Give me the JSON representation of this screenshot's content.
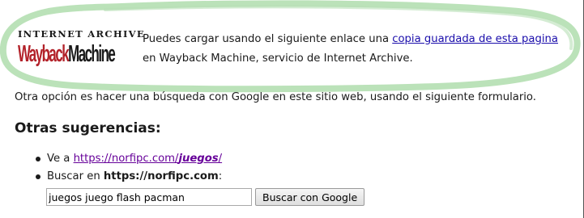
{
  "logo": {
    "top_text": "INTERNET ARCHIVE",
    "wordmark_part1": "Wayback",
    "wordmark_part2": "Machine",
    "brand_color": "#b3222a"
  },
  "intro": {
    "text_before": "Puedes cargar usando el siguiente enlace una ",
    "link_text": "copia guardada de esta pagina",
    "text_after": " en Wayback Machine, servicio de Internet Archive."
  },
  "alt_text": "Otra opción es hacer una búsqueda con Google en este sitio web, usando el siguiente formulario.",
  "suggestions": {
    "heading": "Otras sugerencias:",
    "item1_prefix": "Ve a ",
    "item1_link_base": "https://norfipc.com/",
    "item1_link_em": "juegos",
    "item1_link_tail": "/",
    "item2_prefix": "Buscar en ",
    "item2_bold": "https://norfipc.com",
    "item2_suffix": ":"
  },
  "search": {
    "value": "juegos juego flash pacman",
    "button_label": "Buscar con Google"
  },
  "colors": {
    "link": "#1a0dab",
    "visited_link": "#660099",
    "highlight_stroke": "#b7e0b5"
  }
}
